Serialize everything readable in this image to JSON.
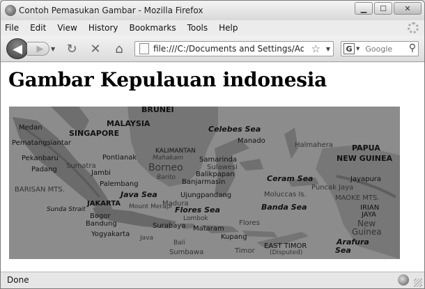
{
  "window": {
    "title": "Contoh Pemasukan Gambar - Mozilla Firefox"
  },
  "menu": [
    "File",
    "Edit",
    "View",
    "History",
    "Bookmarks",
    "Tools",
    "Help"
  ],
  "nav": {
    "url": "file:///C:/Documents and Settings/Adm",
    "search_engine": "G",
    "search_placeholder": "Google"
  },
  "page": {
    "title": "Gambar Kepulauan indonesia"
  },
  "map": {
    "labels": [
      "BRUNEI",
      "MALAYSIA",
      "SINGAPORE",
      "Medan",
      "Pematangsiantar",
      "Pekanbaru",
      "Sumatra",
      "Padang",
      "Pontianak",
      "Jambi",
      "Palembang",
      "BARISAN MTS.",
      "Sunda Strait",
      "JAKARTA",
      "Bogor",
      "Bandung",
      "Yogyakarta",
      "KALIMANTAN",
      "Mahakam",
      "Borneo",
      "Barito",
      "Celebes Sea",
      "Manado",
      "Samarinda",
      "Balikpapan",
      "Sulawesi",
      "Banjarmasin",
      "Java Sea",
      "Ujungpandang",
      "Mount Merapi",
      "Madura",
      "Flores Sea",
      "Lombok",
      "Surabaya",
      "Mataram",
      "Java",
      "Bali",
      "Sumbawa",
      "Flores",
      "Kupang",
      "Timor",
      "EAST TIMOR",
      "(Disputed)",
      "Halmahera",
      "Ceram Sea",
      "Moluccas Is.",
      "Banda Sea",
      "Puncak Jaya",
      "Jayapura",
      "PAPUA",
      "NEW GUINEA",
      "MAOKE MTS.",
      "IRIAN",
      "JAYA",
      "New",
      "Guinea",
      "Arafura",
      "Sea"
    ]
  },
  "status": {
    "text": "Done"
  }
}
